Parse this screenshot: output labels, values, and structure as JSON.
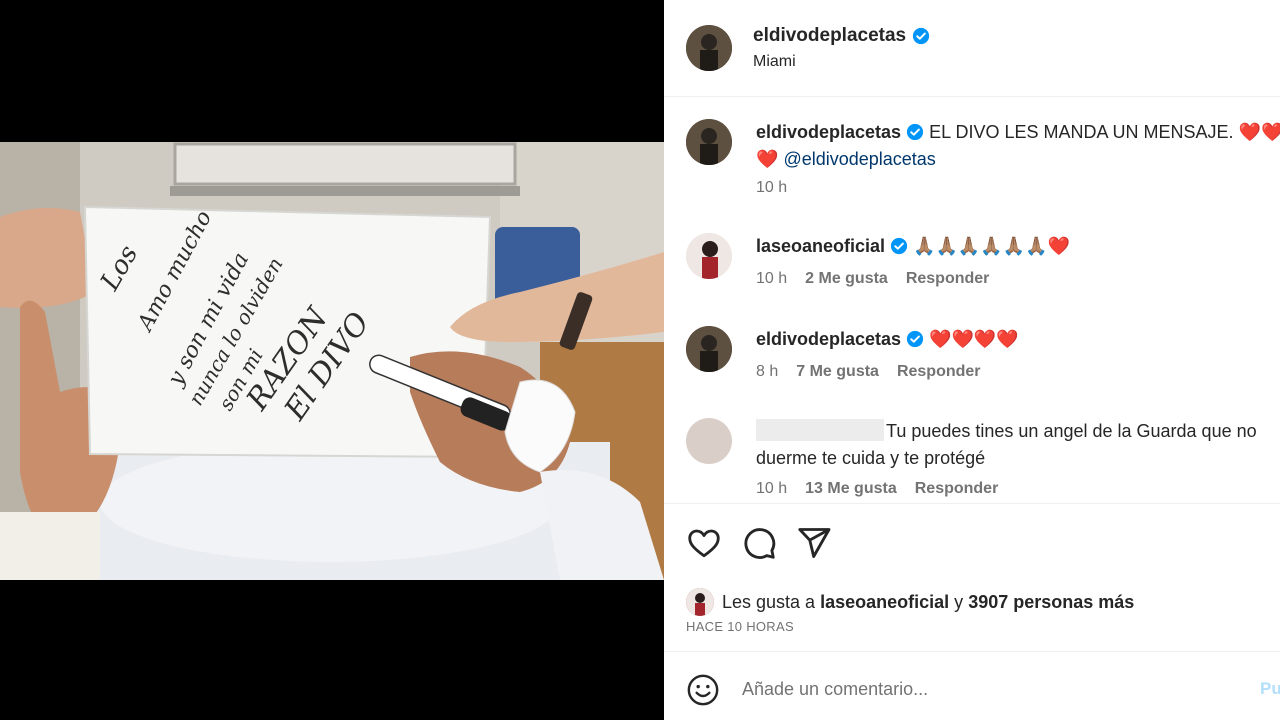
{
  "post": {
    "username": "eldivodeplacetas",
    "location": "Miami"
  },
  "comments": [
    {
      "username": "eldivodeplacetas",
      "text": "EL DIVO LES MANDA UN MENSAJE.",
      "hearts_line1": "❤️❤️",
      "hearts_line2": "❤️",
      "mention": "@eldivodeplacetas",
      "time": "10 h"
    },
    {
      "username": "laseoaneoficial",
      "text": "🙏🏽🙏🏽🙏🏽🙏🏽🙏🏽🙏🏽❤️",
      "time": "10 h",
      "likes": "2 Me gusta",
      "reply": "Responder"
    },
    {
      "username": "eldivodeplacetas",
      "text": "❤️❤️❤️❤️",
      "time": "8 h",
      "likes": "7 Me gusta",
      "reply": "Responder"
    },
    {
      "username": "",
      "text_line1": "Tu puedes tines un angel de la Guarda que no",
      "text_line2": "duerme te cuida y te protégé",
      "time": "10 h",
      "likes": "13 Me gusta",
      "reply": "Responder"
    }
  ],
  "likes_bar": {
    "prefix": "Les gusta a",
    "user": "laseoaneoficial",
    "connector": "y",
    "others": "3907 personas más"
  },
  "time_ago": "HACE 10 HORAS",
  "comment_box": {
    "placeholder": "Añade un comentario...",
    "post_label": "Publicar"
  },
  "photo_note": {
    "line1": "Los",
    "line2": "Amo mucho",
    "line3": "y son mi vida",
    "line4": "nunca lo olviden",
    "line5": "son mi",
    "line6": "RAZON",
    "line7": "El DIVO"
  },
  "colors": {
    "verified": "#0095f6",
    "heart": "#e0162b",
    "mention": "#00376b",
    "secondary_text": "#737373",
    "post_button": "#b2dffc"
  },
  "icons": [
    "heart-outline-icon",
    "comment-icon",
    "share-icon",
    "emoji-icon",
    "verified-icon"
  ]
}
